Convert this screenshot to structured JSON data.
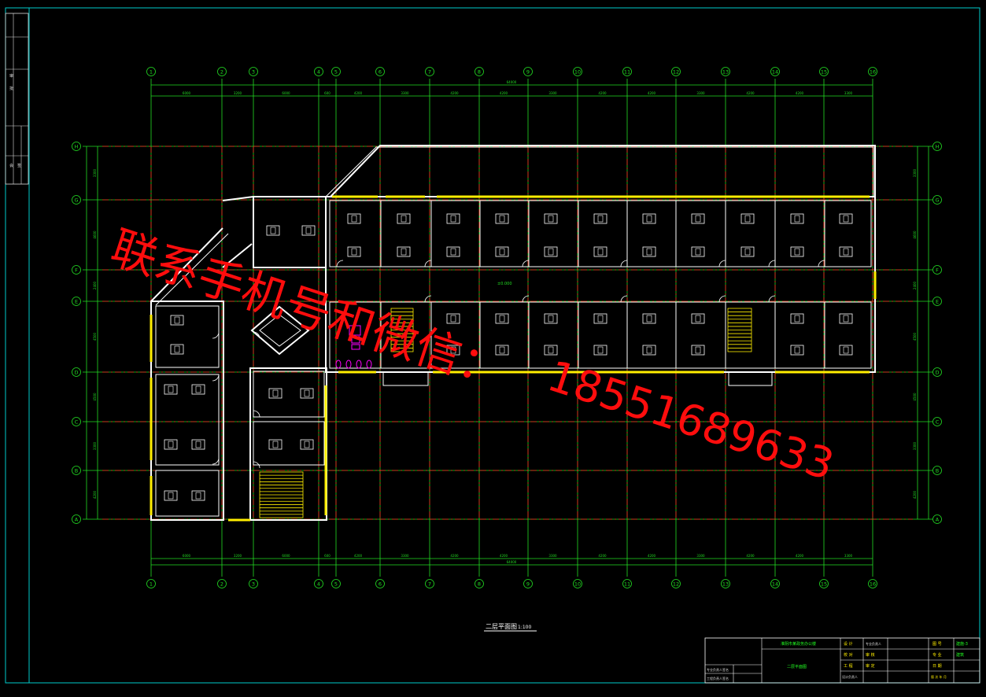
{
  "drawing": {
    "plan_title": "二层平面图",
    "plan_scale": "1:100",
    "grid_cols_top": [
      "1",
      "2",
      "3",
      "4",
      "5",
      "6",
      "7",
      "8",
      "9",
      "10",
      "11",
      "12",
      "13",
      "14",
      "15",
      "16"
    ],
    "grid_rows": [
      "H",
      "G",
      "F",
      "E",
      "D",
      "C",
      "B",
      "A"
    ],
    "total_dim_label": "64000",
    "top_dim_labels": [
      "6000",
      "3200",
      "6000",
      "600",
      "4200",
      "3300",
      "4200",
      "4200",
      "3300",
      "4200",
      "4200",
      "3300",
      "4200",
      "4200",
      "3300"
    ],
    "row_dim_labels": [
      "3300",
      "4600",
      "2400",
      "4500",
      "4500",
      "3300",
      "4200"
    ],
    "corridor_label": "±0.000",
    "colors": {
      "background": "#000000",
      "border": "#00cccc",
      "axis": "#ff2020",
      "dimension": "#22dd22",
      "wall": "#ffffff",
      "window": "#ffee00",
      "fixture": "#ff00ff",
      "watermark": "#ff0d0d"
    }
  },
  "title_block": {
    "school": "淮阴市某政务办公楼",
    "drawing_name": "二层平面图",
    "rows": [
      [
        "设 计",
        "",
        "专业负责人",
        "",
        "图 号",
        "建施-3"
      ],
      [
        "校 对",
        "",
        "审 核",
        "",
        "专 业",
        "建筑"
      ],
      [
        "工 程",
        "",
        "审 定",
        "",
        "日 期",
        ""
      ],
      [
        "设计负责人",
        "",
        "",
        "",
        "版 次 年 月",
        ""
      ]
    ],
    "left_notes": [
      "专业负责人签名",
      "工程负责人签名"
    ]
  },
  "side_strip": {
    "labels": [
      "审",
      "批",
      "会",
      "签"
    ]
  },
  "watermark": {
    "line1": "联系手机号和微信：",
    "line2": "18551689633"
  }
}
